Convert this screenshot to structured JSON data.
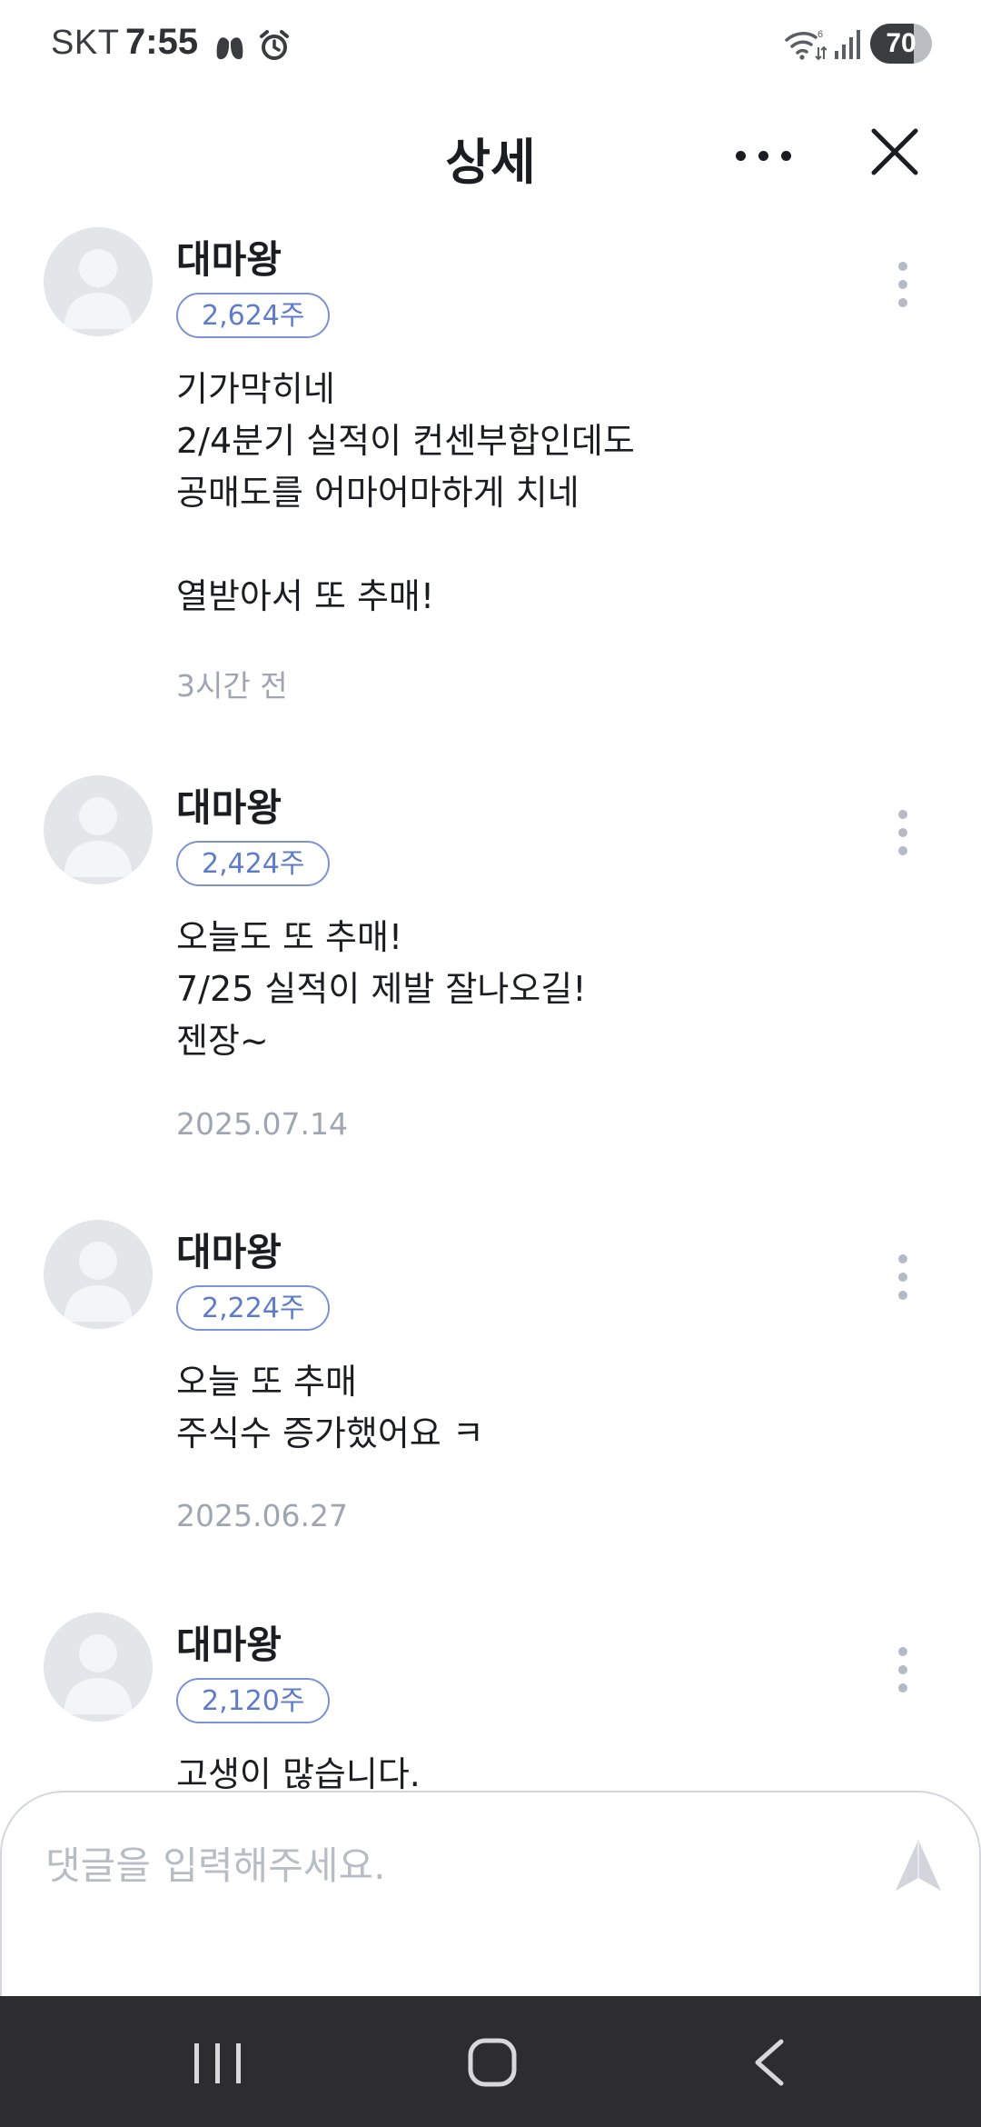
{
  "status_bar": {
    "carrier": "SKT",
    "time": "7:55",
    "battery_level": "70",
    "battery_fraction": 0.7,
    "wifi_badge": "6",
    "icons": [
      "lungs-icon",
      "alarm-icon",
      "wifi-icon",
      "signal-icon",
      "battery-icon"
    ]
  },
  "header": {
    "title": "상세",
    "more_icon": "more-horizontal-icon",
    "close_icon": "close-icon"
  },
  "comments": [
    {
      "author": "대마왕",
      "shares": "2,624주",
      "lines": [
        "기가막히네",
        "2/4분기 실적이 컨센부합인데도",
        "공매도를 어마어마하게 치네",
        "",
        "열받아서 또 추매!"
      ],
      "time": "3시간 전"
    },
    {
      "author": "대마왕",
      "shares": "2,424주",
      "lines": [
        "오늘도 또 추매!",
        "7/25 실적이 제발 잘나오길!",
        "젠장~"
      ],
      "time": "2025.07.14"
    },
    {
      "author": "대마왕",
      "shares": "2,224주",
      "lines": [
        "오늘 또 추매",
        "주식수 증가했어요 ㅋ"
      ],
      "time": "2025.06.27"
    },
    {
      "author": "대마왕",
      "shares": "2,120주",
      "lines": [
        "고생이 많습니다."
      ],
      "time": ""
    }
  ],
  "comment_input": {
    "value": "",
    "placeholder": "댓글을 입력해주세요.",
    "send_icon": "send-icon"
  },
  "nav_bar": {
    "icons": [
      "recent-apps-icon",
      "home-icon",
      "back-icon"
    ]
  },
  "colors": {
    "badge_border": "#7b93d6",
    "badge_text": "#5f7cc9",
    "muted_text": "#a0a6b1",
    "avatar_bg": "#e3e5e9",
    "nav_bg": "#2d2d2f"
  }
}
